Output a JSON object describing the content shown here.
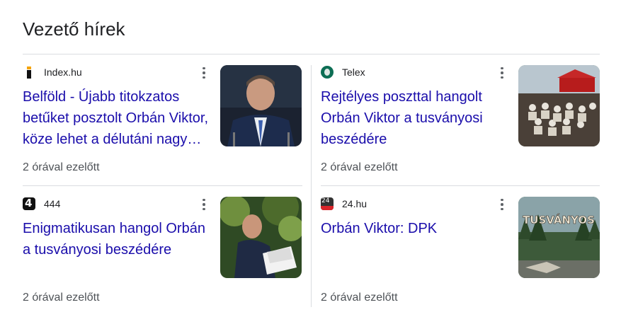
{
  "section": {
    "title": "Vezető hírek"
  },
  "colors": {
    "headline": "#1a0dab",
    "meta": "#4d5156",
    "divider": "#dadce0"
  },
  "cards": [
    {
      "source": "Index.hu",
      "favicon": "index-favicon-icon",
      "headline": "Belföld - Újabb titokzatos betűket posztolt Orbán Viktor, köze lehet a délutáni nagy…",
      "time": "2 órával ezelőtt",
      "thumbnail": "politician-at-podium-photo"
    },
    {
      "source": "Telex",
      "favicon": "telex-favicon-icon",
      "headline": "Rejtélyes poszttal hangolt Orbán Viktor a tusványosi beszédére",
      "time": "2 órával ezelőtt",
      "thumbnail": "outdoor-event-audience-photo"
    },
    {
      "source": "444",
      "favicon": "444-favicon-icon",
      "headline": "Enigmatikusan hangol Orbán a tusványosi beszédére",
      "time": "2 órával ezelőtt",
      "thumbnail": "man-writing-at-desk-photo"
    },
    {
      "source": "24.hu",
      "favicon": "24hu-favicon-icon",
      "headline": "Orbán Viktor: DPK",
      "time": "2 órával ezelőtt",
      "thumbnail": "tusvanyos-sign-photo",
      "thumbnail_text": "TUSVÁNYOS"
    }
  ]
}
